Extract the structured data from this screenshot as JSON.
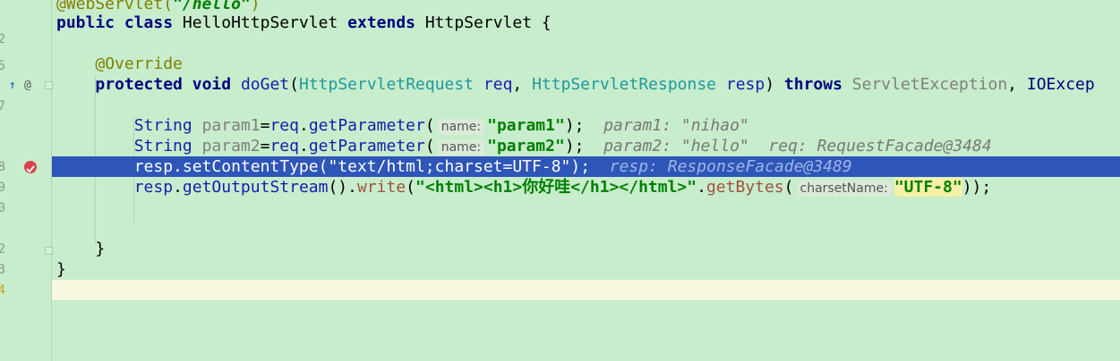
{
  "gutter": {
    "line_numbers": [
      "",
      "2",
      "",
      "5",
      "",
      "7",
      "",
      "",
      "8",
      "9",
      "0",
      "",
      "2",
      "3",
      "4"
    ],
    "override_marker": "↑",
    "annotation_marker": "@"
  },
  "code": {
    "line0_a": "@WebServlet(",
    "line0_b": "\"/hello\"",
    "line0_c": ")",
    "line1_kw1": "public",
    "line1_kw2": "class",
    "line1_name": "HelloHttpServlet",
    "line1_kw3": "extends",
    "line1_super": "HttpServlet",
    "line1_brace": "{",
    "line3_ann": "@Override",
    "line4_kw1": "protected",
    "line4_kw2": "void",
    "line4_meth": "doGet",
    "line4_p1type": "HttpServletRequest",
    "line4_p1": "req",
    "line4_p2type": "HttpServletResponse",
    "line4_p2": "resp",
    "line4_throws": "throws",
    "line4_ex1": "ServletException",
    "line4_ex2": "IOExcep",
    "line6_type": "String",
    "line6_var": "param1",
    "line6_obj": "req",
    "line6_meth": "getParameter",
    "line6_hint": "name:",
    "line6_str": "\"param1\"",
    "line6_inline": "param1: \"nihao\"",
    "line7_type": "String",
    "line7_var": "param2",
    "line7_obj": "req",
    "line7_meth": "getParameter",
    "line7_hint": "name:",
    "line7_str": "\"param2\"",
    "line7_inline": "param2: \"hello\"  req: RequestFacade@3484",
    "line8_code": "resp.setContentType(\"text/html;charset=UTF-8\");",
    "line8_inline": "resp: ResponseFacade@3489",
    "line9_obj": "resp",
    "line9_meth1": "getOutputStream",
    "line9_meth2": "write",
    "line9_str": "\"<html><h1>你好哇</h1></html>\"",
    "line9_meth3": "getBytes",
    "line9_hint": "charsetName:",
    "line9_str2": "\"UTF-8\"",
    "line12_brace": "}",
    "line13_brace": "}"
  }
}
